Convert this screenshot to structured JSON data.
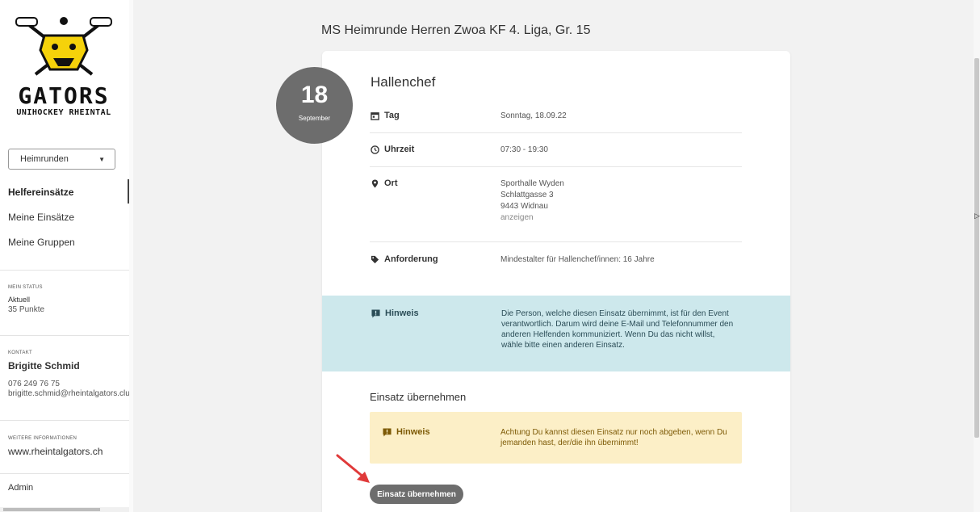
{
  "brand": {
    "name": "GATORS",
    "subtitle": "UNIHOCKEY RHEINTAL"
  },
  "sidebar": {
    "dropdown": {
      "selected": "Heimrunden"
    },
    "nav": [
      {
        "label": "Helfereinsätze"
      },
      {
        "label": "Meine Einsätze"
      },
      {
        "label": "Meine Gruppen"
      }
    ],
    "status": {
      "heading": "MEIN STATUS",
      "label": "Aktuell",
      "value": "35 Punkte"
    },
    "contact": {
      "heading": "KONTAKT",
      "name": "Brigitte Schmid",
      "phone": "076 249 76 75",
      "email": "brigitte.schmid@rheintalgators.clu"
    },
    "info": {
      "heading": "WEITERE INFORMATIONEN",
      "link": "www.rheintalgators.ch"
    },
    "admin": "Admin"
  },
  "main": {
    "title": "MS Heimrunde Herren Zwoa KF 4. Liga, Gr. 15",
    "date": {
      "day": "18",
      "month": "September"
    },
    "card": {
      "title": "Hallenchef",
      "rows": {
        "tag": {
          "label": "Tag",
          "value": "Sonntag, 18.09.22"
        },
        "uhrzeit": {
          "label": "Uhrzeit",
          "value": "07:30 - 19:30"
        },
        "ort": {
          "label": "Ort",
          "line1": "Sporthalle Wyden",
          "line2": "Schlattgasse 3",
          "line3": "9443 Widnau",
          "link": "anzeigen"
        },
        "anforderung": {
          "label": "Anforderung",
          "value": "Mindestalter für Hallenchef/innen: 16 Jahre"
        }
      },
      "hint": {
        "label": "Hinweis",
        "text": "Die Person, welche diesen Einsatz übernimmt, ist für den Event verantwortlich. Darum wird deine E-Mail und Telefonnummer den anderen Helfenden kommuniziert. Wenn Du das nicht willst, wähle bitte einen anderen Einsatz."
      },
      "section_title": "Einsatz übernehmen",
      "warning": {
        "label": "Hinweis",
        "text": "Achtung Du kannst diesen Einsatz nur noch abgeben, wenn Du jemanden hast, der/die ihn übernimmt!"
      },
      "button": "Einsatz übernehmen"
    }
  },
  "colors": {
    "hint_bg": "#cde8ec",
    "warning_bg": "#fcefc7",
    "button_bg": "#6d6d6d",
    "logo_yellow": "#f5d20a",
    "arrow_red": "#e03a3a"
  }
}
